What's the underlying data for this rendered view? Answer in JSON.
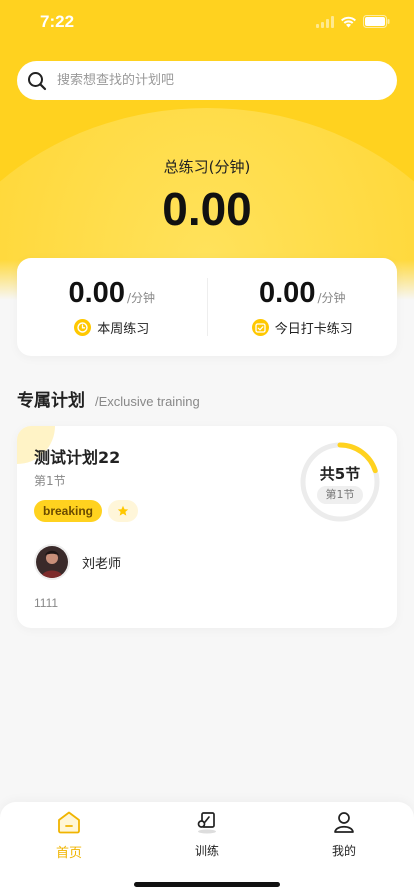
{
  "status_bar": {
    "time": "7:22"
  },
  "search": {
    "placeholder": "搜索想查找的计划吧"
  },
  "summary": {
    "label": "总练习(分钟)",
    "value": "0.00"
  },
  "stats": [
    {
      "value": "0.00",
      "unit": "/分钟",
      "label": "本周练习",
      "icon": "clock-icon"
    },
    {
      "value": "0.00",
      "unit": "/分钟",
      "label": "今日打卡练习",
      "icon": "calendar-icon"
    }
  ],
  "section": {
    "title": "专属计划",
    "subtitle": "/Exclusive training"
  },
  "plan": {
    "title": "测试计划22",
    "lesson": "第1节",
    "tag": "breaking",
    "teacher": "刘老师",
    "note": "1111",
    "total_label": "共5节",
    "current_label": "第1节",
    "progress": 0.2
  },
  "tabs": [
    {
      "label": "首页",
      "icon": "home-icon",
      "active": true
    },
    {
      "label": "训练",
      "icon": "training-icon",
      "active": false
    },
    {
      "label": "我的",
      "icon": "profile-icon",
      "active": false
    }
  ],
  "colors": {
    "accent": "#ffd21f",
    "active_tab": "#f0b400"
  }
}
